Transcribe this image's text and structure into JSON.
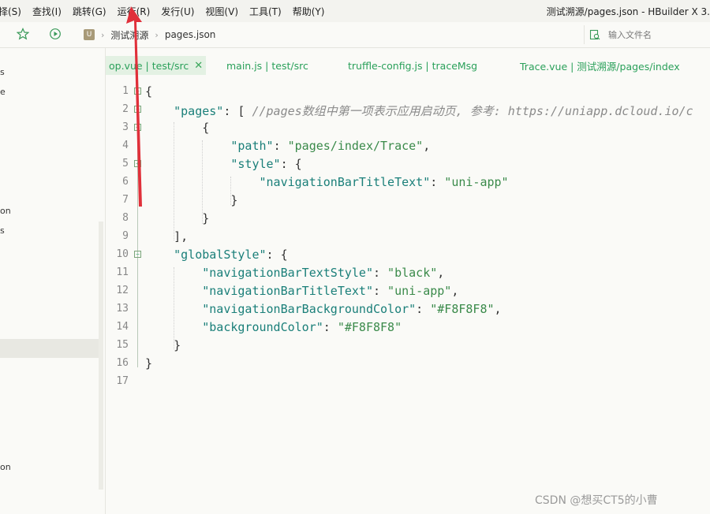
{
  "menubar": {
    "items": [
      "择(S)",
      "查找(I)",
      "跳转(G)",
      "运行(R)",
      "发行(U)",
      "视图(V)",
      "工具(T)",
      "帮助(Y)"
    ],
    "window_title": "测试溯源/pages.json - HBuilder X 3."
  },
  "toolbar": {
    "star_icon": "star-icon",
    "run_icon": "play-circle-icon",
    "project_icon_label": "U",
    "breadcrumb": [
      "测试溯源",
      "pages.json"
    ],
    "file_search_placeholder": "输入文件名"
  },
  "sidebar": {
    "items": [
      "s",
      "e",
      "on",
      "s",
      "on"
    ]
  },
  "tabs": [
    {
      "label": "op.vue | test/src",
      "active": true
    },
    {
      "label": "main.js | test/src",
      "active": false
    },
    {
      "label": "truffle-config.js | traceMsg",
      "active": false
    },
    {
      "label": "Trace.vue | 测试溯源/pages/index",
      "active": false
    }
  ],
  "editor": {
    "line_numbers": [
      "1",
      "2",
      "3",
      "4",
      "5",
      "6",
      "7",
      "8",
      "9",
      "10",
      "11",
      "12",
      "13",
      "14",
      "15",
      "16",
      "17"
    ],
    "lines": [
      [
        {
          "t": "p",
          "v": "{"
        }
      ],
      [
        {
          "t": "k",
          "v": "    \"pages\""
        },
        {
          "t": "p",
          "v": ": [ "
        },
        {
          "t": "c",
          "v": "//pages数组中第一项表示应用启动页, 参考: https://uniapp.dcloud.io/c"
        }
      ],
      [
        {
          "t": "p",
          "v": "        {"
        }
      ],
      [
        {
          "t": "k",
          "v": "            \"path\""
        },
        {
          "t": "p",
          "v": ": "
        },
        {
          "t": "s",
          "v": "\"pages/index/Trace\""
        },
        {
          "t": "p",
          "v": ","
        }
      ],
      [
        {
          "t": "k",
          "v": "            \"style\""
        },
        {
          "t": "p",
          "v": ": {"
        }
      ],
      [
        {
          "t": "k",
          "v": "                \"navigationBarTitleText\""
        },
        {
          "t": "p",
          "v": ": "
        },
        {
          "t": "s",
          "v": "\"uni-app\""
        }
      ],
      [
        {
          "t": "p",
          "v": "            }"
        }
      ],
      [
        {
          "t": "p",
          "v": "        }"
        }
      ],
      [
        {
          "t": "p",
          "v": "    ],"
        }
      ],
      [
        {
          "t": "k",
          "v": "    \"globalStyle\""
        },
        {
          "t": "p",
          "v": ": {"
        }
      ],
      [
        {
          "t": "k",
          "v": "        \"navigationBarTextStyle\""
        },
        {
          "t": "p",
          "v": ": "
        },
        {
          "t": "s",
          "v": "\"black\""
        },
        {
          "t": "p",
          "v": ","
        }
      ],
      [
        {
          "t": "k",
          "v": "        \"navigationBarTitleText\""
        },
        {
          "t": "p",
          "v": ": "
        },
        {
          "t": "s",
          "v": "\"uni-app\""
        },
        {
          "t": "p",
          "v": ","
        }
      ],
      [
        {
          "t": "k",
          "v": "        \"navigationBarBackgroundColor\""
        },
        {
          "t": "p",
          "v": ": "
        },
        {
          "t": "s",
          "v": "\"#F8F8F8\""
        },
        {
          "t": "p",
          "v": ","
        }
      ],
      [
        {
          "t": "k",
          "v": "        \"backgroundColor\""
        },
        {
          "t": "p",
          "v": ": "
        },
        {
          "t": "s",
          "v": "\"#F8F8F8\""
        }
      ],
      [
        {
          "t": "p",
          "v": "    }"
        }
      ],
      [
        {
          "t": "p",
          "v": "}"
        }
      ],
      []
    ],
    "fold_markers": [
      "⊟",
      "⊟",
      "⊟",
      "",
      "⊞",
      "",
      "",
      "",
      "",
      "⊟",
      "",
      "",
      "",
      "",
      "",
      "",
      ""
    ]
  },
  "watermark": "CSDN @想买CT5的小曹",
  "colors": {
    "accent_green": "#2aa05a",
    "annotation_arrow": "#e0303a"
  }
}
